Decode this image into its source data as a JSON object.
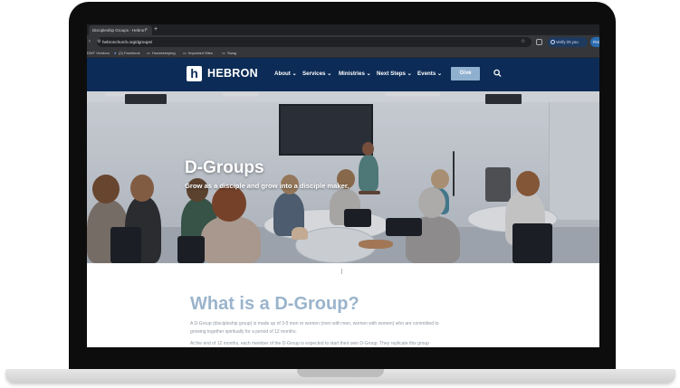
{
  "browser": {
    "tab_title": "Discipleship Groups - Hebron",
    "tab_close": "×",
    "new_tab": "+",
    "url": "hebronchurch.org/dgroups/",
    "verify_label": "Verify it's you",
    "fin_label": "Fini",
    "bookmarks": [
      "DWT Vendors",
      "(2) Facebook",
      "Housekeeping",
      "Important Sites",
      "Swag"
    ]
  },
  "site": {
    "logo_mark": "h",
    "logo_text": "HEBRON",
    "menu": [
      "About",
      "Services",
      "Ministries",
      "Next Steps",
      "Events"
    ],
    "give_label": "Give",
    "brand_color": "#0c2c57",
    "accent_color": "#8fb0cf"
  },
  "hero": {
    "title": "D-Groups",
    "subtitle": "Grow as a disciple and grow into a disciple maker."
  },
  "content": {
    "heading": "What is a D-Group?",
    "paragraph_1a": "A D-Group (discipleship group) is made up of 3-5 men or women (men with men, women with women) who are committed to",
    "paragraph_1b": "growing together spiritually for a period of 12 months.",
    "paragraph_2": "At the end of 12 months, each member of the D-Group is expected to start their own D-Group. They replicate this group"
  }
}
